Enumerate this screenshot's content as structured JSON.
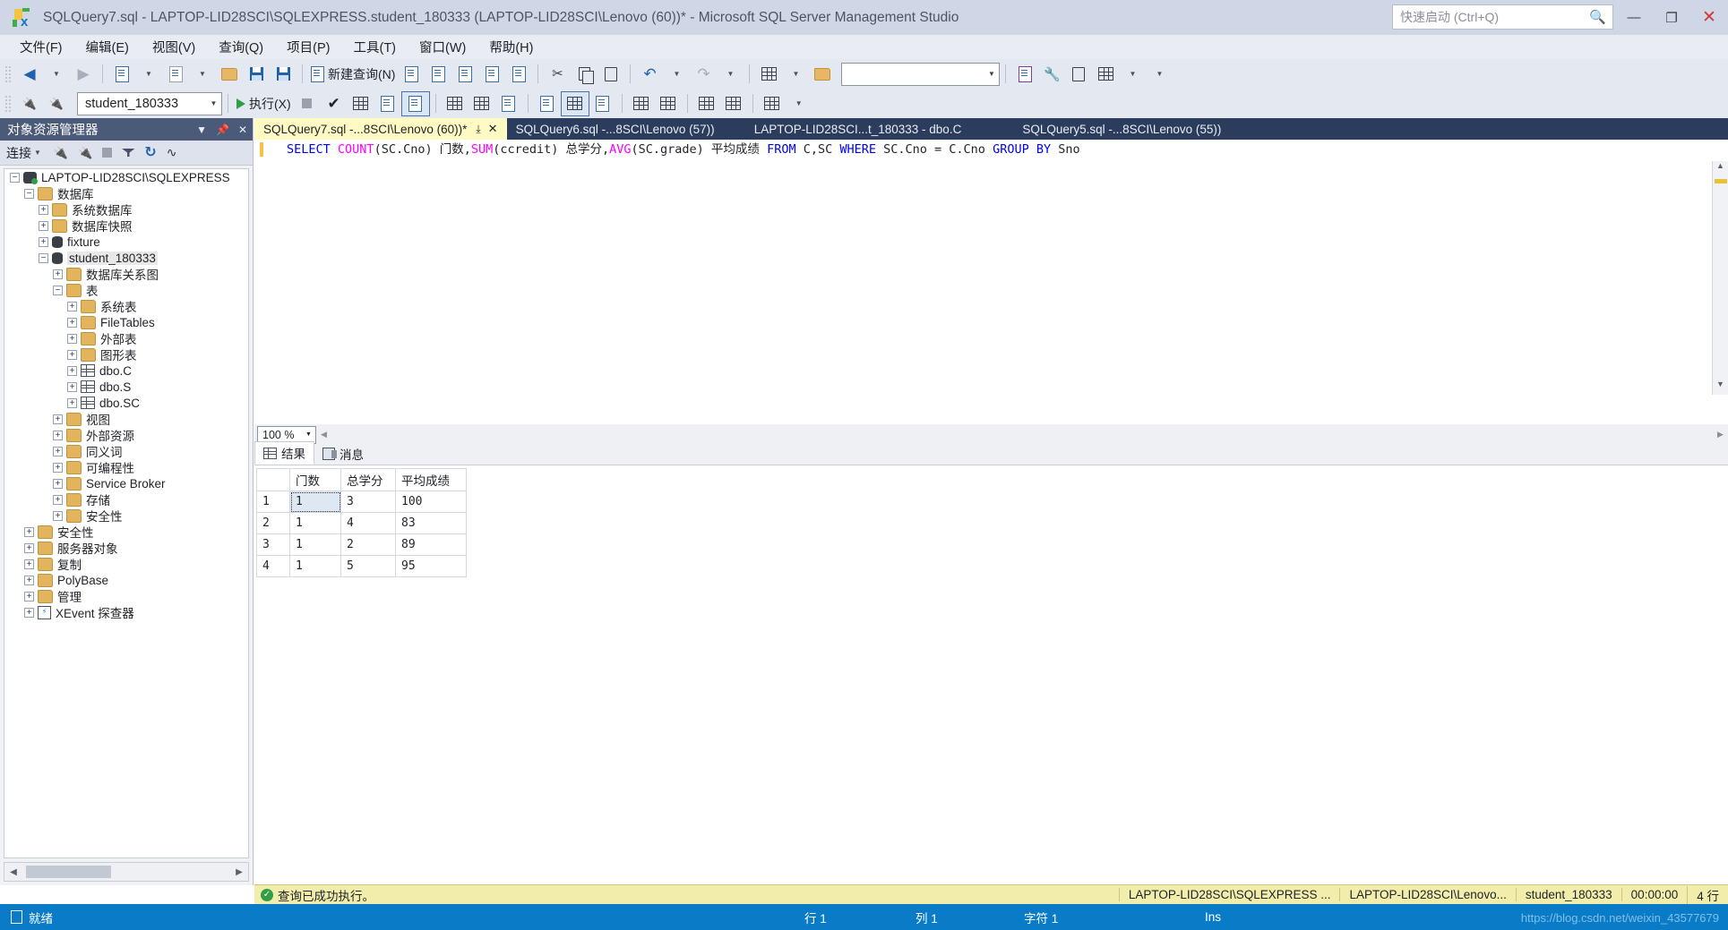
{
  "window": {
    "title": "SQLQuery7.sql - LAPTOP-LID28SCI\\SQLEXPRESS.student_180333 (LAPTOP-LID28SCI\\Lenovo (60))* - Microsoft SQL Server Management Studio",
    "minimize_label": "—",
    "maximize_label": "❐",
    "close_label": "✕"
  },
  "quick_launch": {
    "placeholder": "快速启动 (Ctrl+Q)",
    "icon": "search-icon"
  },
  "menu": {
    "items": [
      {
        "label": "文件(F)"
      },
      {
        "label": "编辑(E)"
      },
      {
        "label": "视图(V)"
      },
      {
        "label": "查询(Q)"
      },
      {
        "label": "项目(P)"
      },
      {
        "label": "工具(T)"
      },
      {
        "label": "窗口(W)"
      },
      {
        "label": "帮助(H)"
      }
    ]
  },
  "toolbar_main": {
    "new_query_label": "新建查询(N)",
    "mdx_label": "MDX",
    "dmx_label": "DMX",
    "xmla_label": "XMLA",
    "dax_label": "DAX",
    "search_value": ""
  },
  "toolbar_query": {
    "database_value": "student_180333",
    "execute_label": "执行(X)"
  },
  "object_explorer": {
    "title": "对象资源管理器",
    "connect_label": "连接",
    "tree": [
      {
        "label": "LAPTOP-LID28SCI\\SQLEXPRESS",
        "depth": 0,
        "state": "minus",
        "icon": "server",
        "selected": false
      },
      {
        "label": "数据库",
        "depth": 1,
        "state": "minus",
        "icon": "folder",
        "selected": false
      },
      {
        "label": "系统数据库",
        "depth": 2,
        "state": "plus",
        "icon": "folder",
        "selected": false
      },
      {
        "label": "数据库快照",
        "depth": 2,
        "state": "plus",
        "icon": "folder",
        "selected": false
      },
      {
        "label": "fixture",
        "depth": 2,
        "state": "plus",
        "icon": "db",
        "selected": false
      },
      {
        "label": "student_180333",
        "depth": 2,
        "state": "minus",
        "icon": "db",
        "selected": true
      },
      {
        "label": "数据库关系图",
        "depth": 3,
        "state": "plus",
        "icon": "folder",
        "selected": false
      },
      {
        "label": "表",
        "depth": 3,
        "state": "minus",
        "icon": "folder",
        "selected": false
      },
      {
        "label": "系统表",
        "depth": 4,
        "state": "plus",
        "icon": "folder",
        "selected": false
      },
      {
        "label": "FileTables",
        "depth": 4,
        "state": "plus",
        "icon": "folder",
        "selected": false
      },
      {
        "label": "外部表",
        "depth": 4,
        "state": "plus",
        "icon": "folder",
        "selected": false
      },
      {
        "label": "图形表",
        "depth": 4,
        "state": "plus",
        "icon": "folder",
        "selected": false
      },
      {
        "label": "dbo.C",
        "depth": 4,
        "state": "plus",
        "icon": "table",
        "selected": false
      },
      {
        "label": "dbo.S",
        "depth": 4,
        "state": "plus",
        "icon": "table",
        "selected": false
      },
      {
        "label": "dbo.SC",
        "depth": 4,
        "state": "plus",
        "icon": "table",
        "selected": false
      },
      {
        "label": "视图",
        "depth": 3,
        "state": "plus",
        "icon": "folder",
        "selected": false
      },
      {
        "label": "外部资源",
        "depth": 3,
        "state": "plus",
        "icon": "folder",
        "selected": false
      },
      {
        "label": "同义词",
        "depth": 3,
        "state": "plus",
        "icon": "folder",
        "selected": false
      },
      {
        "label": "可编程性",
        "depth": 3,
        "state": "plus",
        "icon": "folder",
        "selected": false
      },
      {
        "label": "Service Broker",
        "depth": 3,
        "state": "plus",
        "icon": "folder",
        "selected": false
      },
      {
        "label": "存储",
        "depth": 3,
        "state": "plus",
        "icon": "folder",
        "selected": false
      },
      {
        "label": "安全性",
        "depth": 3,
        "state": "plus",
        "icon": "folder",
        "selected": false
      },
      {
        "label": "安全性",
        "depth": 1,
        "state": "plus",
        "icon": "folder",
        "selected": false
      },
      {
        "label": "服务器对象",
        "depth": 1,
        "state": "plus",
        "icon": "folder",
        "selected": false
      },
      {
        "label": "复制",
        "depth": 1,
        "state": "plus",
        "icon": "folder",
        "selected": false
      },
      {
        "label": "PolyBase",
        "depth": 1,
        "state": "plus",
        "icon": "folder",
        "selected": false
      },
      {
        "label": "管理",
        "depth": 1,
        "state": "plus",
        "icon": "folder",
        "selected": false
      },
      {
        "label": "XEvent 探查器",
        "depth": 1,
        "state": "plus",
        "icon": "xevent",
        "selected": false
      }
    ]
  },
  "editor": {
    "tabs": [
      {
        "label": "SQLQuery7.sql -...8SCI\\Lenovo (60))*",
        "active": true,
        "closeable": true
      },
      {
        "label": "SQLQuery6.sql -...8SCI\\Lenovo (57))",
        "active": false,
        "closeable": false
      },
      {
        "label": "LAPTOP-LID28SCI...t_180333 - dbo.C",
        "active": false,
        "closeable": false
      },
      {
        "label": "SQLQuery5.sql -...8SCI\\Lenovo (55))",
        "active": false,
        "closeable": false
      }
    ],
    "sql_tokens": [
      {
        "t": "SELECT",
        "c": "kw"
      },
      {
        "t": " ",
        "c": ""
      },
      {
        "t": "COUNT",
        "c": "fn"
      },
      {
        "t": "(SC.Cno) 门数,",
        "c": ""
      },
      {
        "t": "SUM",
        "c": "fn"
      },
      {
        "t": "(ccredit) 总学分,",
        "c": ""
      },
      {
        "t": "AVG",
        "c": "fn"
      },
      {
        "t": "(SC.grade) 平均成绩 ",
        "c": ""
      },
      {
        "t": "FROM",
        "c": "kw"
      },
      {
        "t": " C,SC ",
        "c": ""
      },
      {
        "t": "WHERE",
        "c": "kw"
      },
      {
        "t": " SC.Cno = C.Cno ",
        "c": ""
      },
      {
        "t": "GROUP BY",
        "c": "kw"
      },
      {
        "t": " Sno",
        "c": ""
      }
    ],
    "sql_plain": "SELECT COUNT(SC.Cno) 门数,SUM(ccredit) 总学分,AVG(SC.grade) 平均成绩 FROM C,SC WHERE SC.Cno = C.Cno GROUP BY Sno",
    "zoom_level": "100 %"
  },
  "results": {
    "tabs": [
      {
        "label": "结果",
        "icon": "grid-icon",
        "active": true
      },
      {
        "label": "消息",
        "icon": "message-icon",
        "active": false
      }
    ],
    "grid": {
      "columns": [
        "门数",
        "总学分",
        "平均成绩"
      ],
      "rows": [
        {
          "num": "1",
          "cells": [
            "1",
            "3",
            "100"
          ]
        },
        {
          "num": "2",
          "cells": [
            "1",
            "4",
            "83"
          ]
        },
        {
          "num": "3",
          "cells": [
            "1",
            "2",
            "89"
          ]
        },
        {
          "num": "4",
          "cells": [
            "1",
            "5",
            "95"
          ]
        }
      ],
      "selected_cell": {
        "row": 0,
        "col": 0
      }
    }
  },
  "exec_status": {
    "message": "查询已成功执行。",
    "server": "LAPTOP-LID28SCI\\SQLEXPRESS ...",
    "user": "LAPTOP-LID28SCI\\Lenovo...",
    "database": "student_180333",
    "elapsed": "00:00:00",
    "rowcount": "4 行"
  },
  "statusbar": {
    "ready": "就绪",
    "line": "行 1",
    "column": "列 1",
    "char": "字符 1",
    "insert_mode": "Ins",
    "watermark": "https://blog.csdn.net/weixin_43577679"
  },
  "colors": {
    "title_bar": "#cfd6e5",
    "accent_blue": "#0a7cc7",
    "tab_active": "#fff9c4",
    "tabstrip": "#2b3c5c",
    "oe_header": "#4a5a78",
    "status_yellow": "#f2edab",
    "keyword": "#0000ff",
    "function": "#ff00ff"
  }
}
